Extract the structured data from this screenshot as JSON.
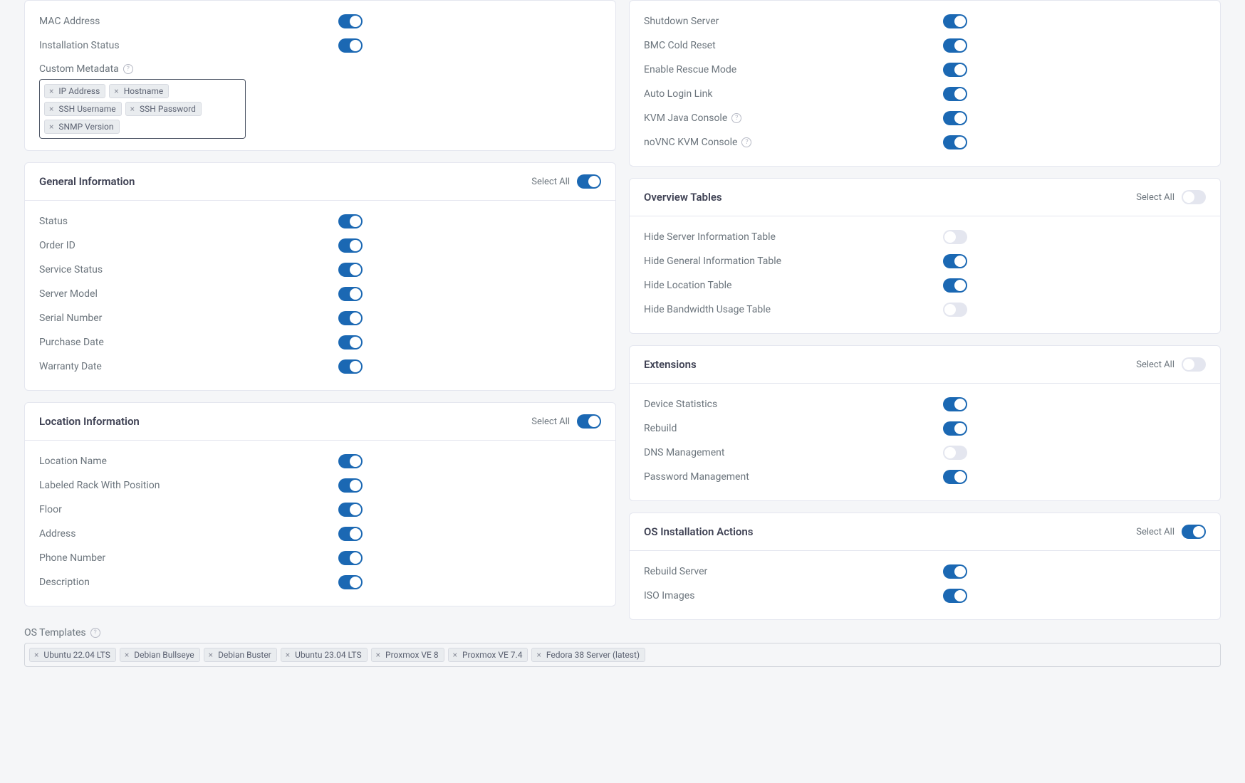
{
  "left": {
    "topRows": [
      {
        "label": "MAC Address",
        "on": true
      },
      {
        "label": "Installation Status",
        "on": true
      }
    ],
    "customMetadata": {
      "label": "Custom Metadata"
    },
    "tags": [
      "IP Address",
      "Hostname",
      "SSH Username",
      "SSH Password",
      "SNMP Version"
    ],
    "general": {
      "title": "General Information",
      "selectAll": "Select All",
      "items": [
        {
          "label": "Status",
          "on": true
        },
        {
          "label": "Order ID",
          "on": true
        },
        {
          "label": "Service Status",
          "on": true
        },
        {
          "label": "Server Model",
          "on": true
        },
        {
          "label": "Serial Number",
          "on": true
        },
        {
          "label": "Purchase Date",
          "on": true
        },
        {
          "label": "Warranty Date",
          "on": true
        }
      ]
    },
    "location": {
      "title": "Location Information",
      "selectAll": "Select All",
      "items": [
        {
          "label": "Location Name",
          "on": true
        },
        {
          "label": "Labeled Rack With Position",
          "on": true
        },
        {
          "label": "Floor",
          "on": true
        },
        {
          "label": "Address",
          "on": true
        },
        {
          "label": "Phone Number",
          "on": true
        },
        {
          "label": "Description",
          "on": true
        }
      ]
    }
  },
  "right": {
    "topRows": [
      {
        "label": "Shutdown Server",
        "on": true
      },
      {
        "label": "BMC Cold Reset",
        "on": true
      },
      {
        "label": "Enable Rescue Mode",
        "on": true
      },
      {
        "label": "Auto Login Link",
        "on": true
      },
      {
        "label": "KVM Java Console",
        "on": true,
        "help": true
      },
      {
        "label": "noVNC KVM Console",
        "on": true,
        "help": true
      }
    ],
    "overview": {
      "title": "Overview Tables",
      "selectAll": "Select All",
      "selectAllOn": false,
      "items": [
        {
          "label": "Hide Server Information Table",
          "on": false
        },
        {
          "label": "Hide General Information Table",
          "on": true
        },
        {
          "label": "Hide Location Table",
          "on": true
        },
        {
          "label": "Hide Bandwidth Usage Table",
          "on": false
        }
      ]
    },
    "extensions": {
      "title": "Extensions",
      "selectAll": "Select All",
      "selectAllOn": false,
      "items": [
        {
          "label": "Device Statistics",
          "on": true
        },
        {
          "label": "Rebuild",
          "on": true
        },
        {
          "label": "DNS Management",
          "on": false
        },
        {
          "label": "Password Management",
          "on": true
        }
      ]
    },
    "osActions": {
      "title": "OS Installation Actions",
      "selectAll": "Select All",
      "selectAllOn": true,
      "items": [
        {
          "label": "Rebuild Server",
          "on": true
        },
        {
          "label": "ISO Images",
          "on": true
        }
      ]
    }
  },
  "osTemplates": {
    "label": "OS Templates",
    "tags": [
      "Ubuntu 22.04 LTS",
      "Debian Bullseye",
      "Debian Buster",
      "Ubuntu 23.04 LTS",
      "Proxmox VE 8",
      "Proxmox VE 7.4",
      "Fedora 38 Server (latest)"
    ]
  }
}
